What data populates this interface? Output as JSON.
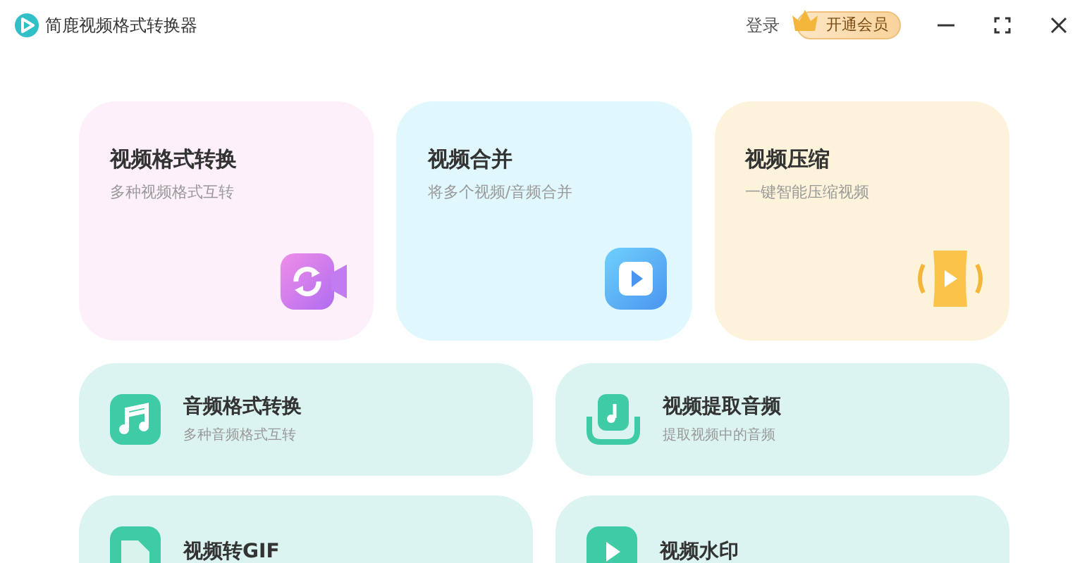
{
  "window": {
    "title": "简鹿视频格式转换器",
    "login": "登录",
    "vip_button": "开通会员"
  },
  "feature_cards": [
    {
      "kind": "video-convert",
      "title": "视频格式转换",
      "subtitle": "多种视频格式互转"
    },
    {
      "kind": "video-merge",
      "title": "视频合并",
      "subtitle": "将多个视频/音频合并"
    },
    {
      "kind": "video-compress",
      "title": "视频压缩",
      "subtitle": "一键智能压缩视频"
    }
  ],
  "tool_rows": [
    {
      "kind": "audio-convert",
      "title": "音频格式转换",
      "subtitle": "多种音频格式互转"
    },
    {
      "kind": "extract-audio",
      "title": "视频提取音频",
      "subtitle": "提取视频中的音频"
    },
    {
      "kind": "gif",
      "title": "视频转GIF"
    },
    {
      "kind": "watermark",
      "title": "视频水印"
    }
  ]
}
